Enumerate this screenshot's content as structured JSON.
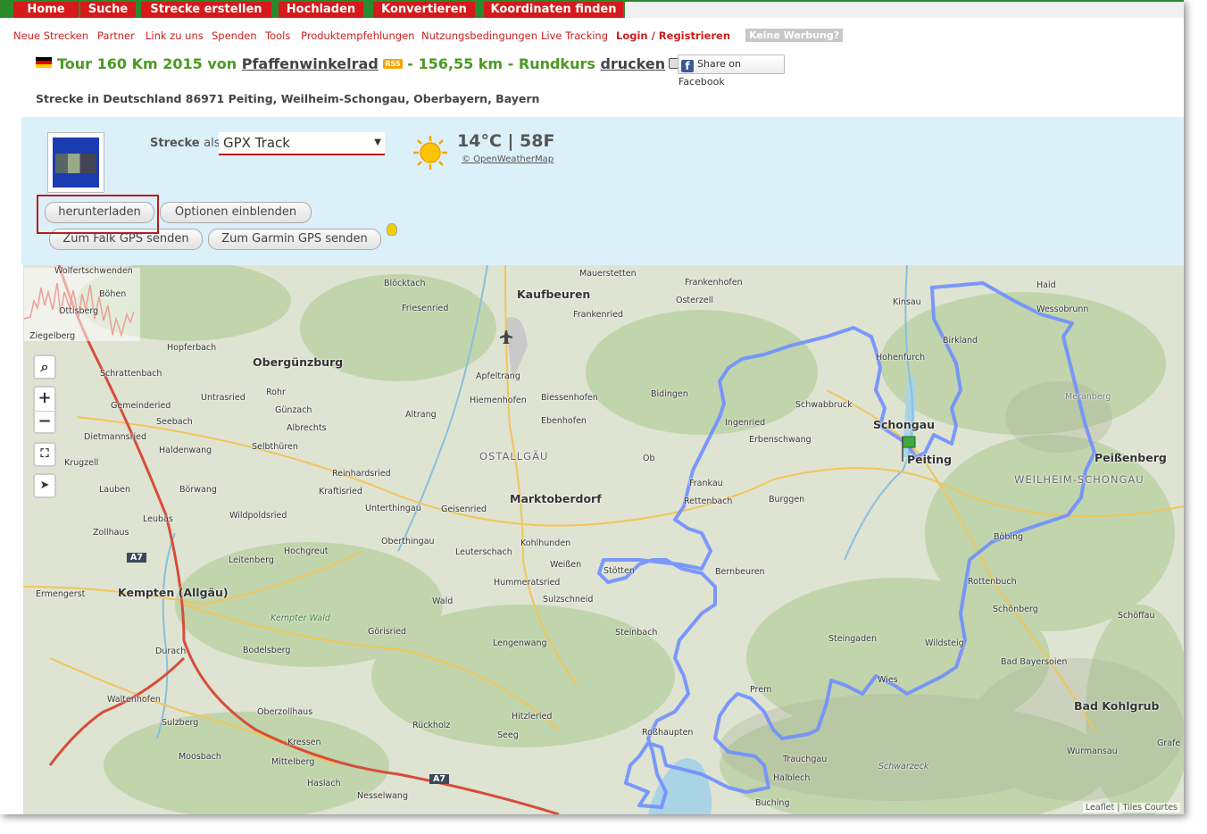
{
  "nav": {
    "tabs": [
      "Home",
      "Suche",
      "Strecke erstellen",
      "Hochladen",
      "Konvertieren",
      "Koordinaten finden"
    ]
  },
  "subnav": {
    "links": [
      "Neue Strecken",
      "Partner",
      "Link zu uns",
      "Spenden",
      "Tools",
      "Produktempfehlungen",
      "Nutzungsbedingungen",
      "Live Tracking"
    ],
    "login": "Login / Registrieren",
    "no_ads": "Keine Werbung?"
  },
  "title": {
    "prefix": "Tour 160 Km 2015 von",
    "user": "Pfaffenwinkelrad",
    "rss": "RSS",
    "distance": "- 156,55 km - Rundkurs",
    "print": "drucken"
  },
  "facebook": "Share on Facebook",
  "location": "Strecke in Deutschland 86971 Peiting, Weilheim-Schongau, Oberbayern, Bayern",
  "panel": {
    "strecke": "Strecke",
    "als": "als",
    "format": "GPX Track",
    "temperature": "14°C | 58F",
    "weather_source": "© OpenWeatherMap",
    "download": "herunterladen",
    "options": "Optionen einblenden",
    "falk": "Zum Falk GPS senden",
    "garmin": "Zum Garmin GPS senden"
  },
  "map": {
    "zoom_in": "+",
    "zoom_out": "−",
    "attribution": "Leaflet | Tiles Courtes",
    "towns": {
      "kaufbeuren": "Kaufbeuren",
      "obergunzburg": "Obergünzburg",
      "marktoberdorf": "Marktoberdorf",
      "kempten": "Kempten (Allgäu)",
      "schongau": "Schongau",
      "peiting": "Peiting",
      "peissenberg": "Peißenberg",
      "bad_kohlgrub": "Bad Kohlgrub"
    },
    "regions": {
      "ostallgau": "OSTALLGÄU",
      "weilheim": "WEILHEIM-SCHONGAU"
    },
    "villages": {
      "wolfertschwenden": "Wolfertschwenden",
      "bohen": "Böhen",
      "ottisberg": "Ottisberg",
      "ziegelberg": "Ziegelberg",
      "hopferbach": "Hopferbach",
      "schrattenbach": "Schrattenbach",
      "untrasried": "Untrasried",
      "rohr": "Rohr",
      "gunzach": "Günzach",
      "albrechts": "Albrechts",
      "gemeinderied": "Gemeinderied",
      "seebach": "Seebach",
      "dietmannsried": "Dietmannsried",
      "haldenwang": "Haldenwang",
      "selbthuren": "Selbthüren",
      "krugzell": "Krugzell",
      "lauben": "Lauben",
      "borwang": "Börwang",
      "leubas": "Leubas",
      "zollhaus": "Zollhaus",
      "wildpoldsried": "Wildpoldsried",
      "leitenberg": "Leitenberg",
      "hochgreut": "Hochgreut",
      "kraftisried": "Kraftisried",
      "reinhardsried": "Reinhardsried",
      "unterthingau": "Unterthingau",
      "geisenried": "Geisenried",
      "oberthingau": "Oberthingau",
      "blocktach": "Blöcktach",
      "friesenried": "Friesenried",
      "apfeltrang": "Apfeltrang",
      "hiemenhofen": "Hiemenhofen",
      "altrang": "Altrang",
      "biessenhofen": "Biessenhofen",
      "ebenhofen": "Ebenhofen",
      "mauerstetten": "Mauerstetten",
      "frankenried": "Frankenried",
      "frankenhofen": "Frankenhofen",
      "osterzell": "Osterzell",
      "bidingen": "Bidingen",
      "ingenried": "Ingenried",
      "erbenschwang": "Erbenschwang",
      "schwabbruck": "Schwabbruck",
      "kinsau": "Kinsau",
      "hohenfurch": "Hohenfurch",
      "birkland": "Birkland",
      "haid": "Haid",
      "wessobrunn": "Wessobrunn",
      "meranberg": "Meranberg",
      "kohlhunden": "Kohlhunden",
      "leuterschach": "Leuterschach",
      "weissen": "Weißen",
      "hummeratsried": "Hummeratsried",
      "sulzschneid": "Sulzschneid",
      "stotten": "Stötten",
      "bernbeuren": "Bernbeuren",
      "rettenbach": "Rettenbach",
      "frankau": "Frankau",
      "burggen": "Burggen",
      "ob": "Ob",
      "ermengerst": "Ermengerst",
      "durach": "Durach",
      "kempter_wald": "Kempter Wald",
      "gorisried": "Görisried",
      "wald": "Wald",
      "lengenwang": "Lengenwang",
      "steinbach": "Steinbach",
      "bodelsberg": "Bodelsberg",
      "waltenhofen": "Waltenhofen",
      "sulzberg": "Sulzberg",
      "oberzollhaus": "Oberzollhaus",
      "ruckholz": "Rückholz",
      "hitzleried": "Hitzleried",
      "seeg": "Seeg",
      "rosshaupten": "Roßhaupten",
      "kressen": "Kressen",
      "moosbach": "Moosbach",
      "mittelberg": "Mittelberg",
      "haslach": "Haslach",
      "nesselwang": "Nesselwang",
      "steingaden": "Steingaden",
      "wildsteig": "Wildsteig",
      "prem": "Prem",
      "trauchgau": "Trauchgau",
      "halblech": "Halblech",
      "buching": "Buching",
      "schwarzeck": "Schwarzeck",
      "rottenbuch": "Rottenbuch",
      "bobing": "Böbing",
      "schonberg": "Schönberg",
      "schoffau": "Schöffau",
      "bad_bayersoien": "Bad Bayersoien",
      "wurmansau": "Wurmansau",
      "grafe": "Grafe",
      "wies": "Wies",
      "a7_1": "A7",
      "a7_2": "A7"
    }
  }
}
